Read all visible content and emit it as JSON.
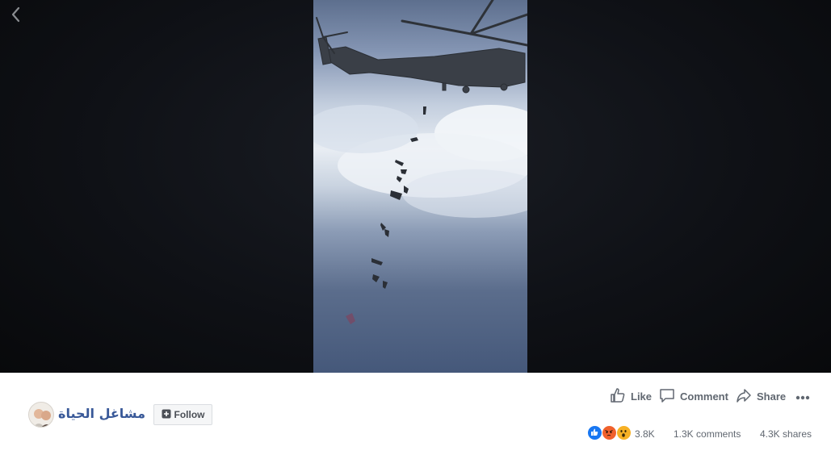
{
  "video": {
    "subject": "helicopter-parachutists"
  },
  "page": {
    "name": "مشاغل الحياة"
  },
  "follow": {
    "label": "Follow"
  },
  "actions": {
    "like_label": "Like",
    "comment_label": "Comment",
    "share_label": "Share"
  },
  "stats": {
    "reaction_count": "3.8K",
    "comments": "1.3K comments",
    "shares": "4.3K shares"
  },
  "reactions": [
    "like",
    "angry",
    "wow"
  ],
  "colors": {
    "link_blue": "#385898",
    "text_gray": "#606770",
    "like_blue": "#1877f2",
    "angry_orange": "#f0612c",
    "wow_yellow": "#f7b125"
  }
}
